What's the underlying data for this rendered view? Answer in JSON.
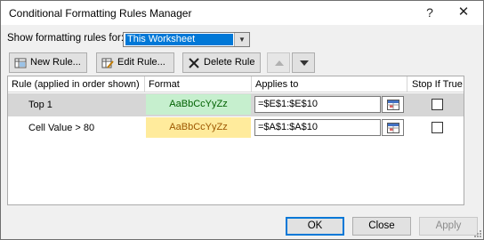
{
  "window": {
    "title": "Conditional Formatting Rules Manager",
    "help_glyph": "?",
    "close_glyph": "✕"
  },
  "show_rules": {
    "label": "Show formatting rules for:",
    "value": "This Worksheet"
  },
  "toolbar": {
    "new_rule": "New Rule...",
    "edit_rule": "Edit Rule...",
    "delete_rule": "Delete Rule"
  },
  "table": {
    "headers": {
      "rule": "Rule (applied in order shown)",
      "format": "Format",
      "applies": "Applies to",
      "stop": "Stop If True"
    },
    "rows": [
      {
        "rule": "Top 1",
        "format_preview": "AaBbCcYyZz",
        "applies_to": "=$E$1:$E$10",
        "stop_if_true": false,
        "selected": true,
        "fill_color": "#c6efce",
        "text_color": "#006100"
      },
      {
        "rule": "Cell Value > 80",
        "format_preview": "AaBbCcYyZz",
        "applies_to": "=$A$1:$A$10",
        "stop_if_true": false,
        "selected": false,
        "fill_color": "#ffeb9c",
        "text_color": "#9c5700"
      }
    ]
  },
  "buttons": {
    "ok": "OK",
    "close": "Close",
    "apply": "Apply"
  },
  "colors": {
    "selection": "#0078d7",
    "selected_row": "#d6d6d6"
  }
}
